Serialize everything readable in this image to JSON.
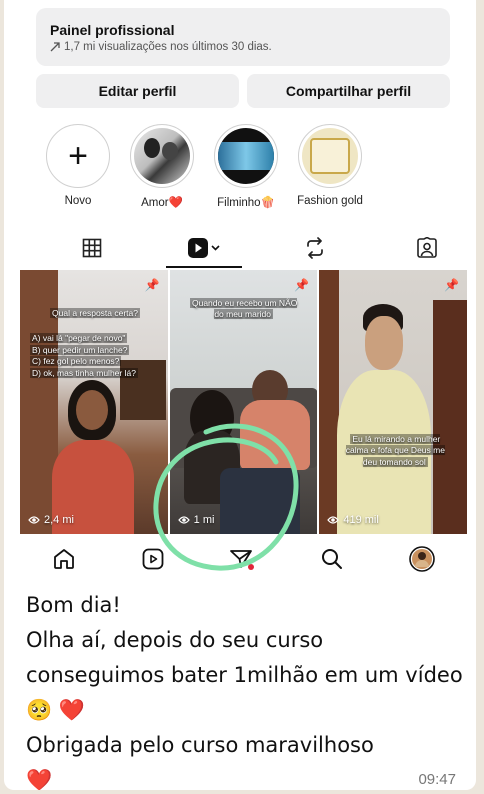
{
  "panel": {
    "title": "Painel profissional",
    "subtitle": "1,7 mi visualizações nos últimos 30 dias."
  },
  "buttons": {
    "edit": "Editar perfil",
    "share": "Compartilhar perfil"
  },
  "highlights": [
    {
      "label": "Novo"
    },
    {
      "label": "Amor❤️"
    },
    {
      "label": "Filminho🍿"
    },
    {
      "label": "Fashion gold"
    }
  ],
  "reels": [
    {
      "views": "2,4 mi",
      "caption_title": "Qual a resposta certa?",
      "caption_lines": [
        "A) vai lá \"pegar de novo\"",
        "B) quer pedir um lanche?",
        "C) fez gol pelo menos?",
        "D) ok, mas tinha mulher lá?"
      ]
    },
    {
      "views": "1 mi",
      "caption": "Quando eu recebo um NÃO do meu marido"
    },
    {
      "views": "419 mil",
      "caption": "Eu lá mirando a mulher calma e fofa que Deus me deu tomando sol"
    }
  ],
  "message": {
    "line1": "Bom dia!",
    "line2": "Olha aí, depois do seu curso conseguimos bater 1milhão em um vídeo 🥺",
    "line3": "Obrigada pelo curso maravilhoso",
    "time": "09:47"
  },
  "colors": {
    "highlight_circle": "#7fe0a8",
    "heart": "#d9262c"
  }
}
